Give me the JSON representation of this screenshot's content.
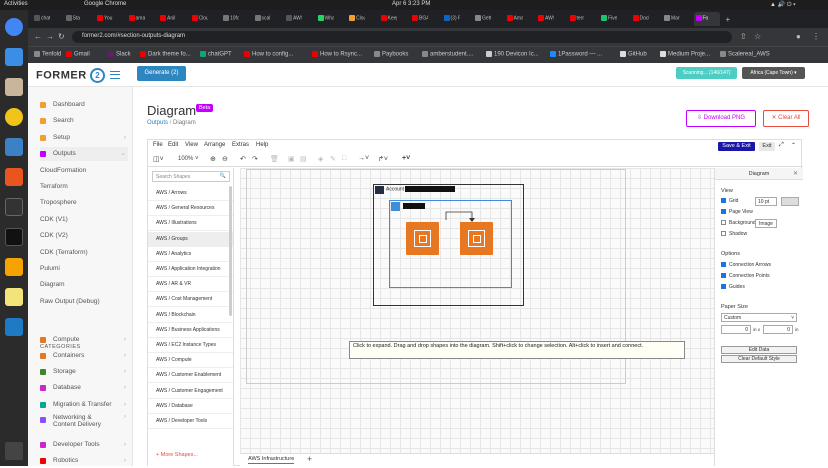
{
  "os": {
    "activities": "Activities",
    "app": "Google Chrome",
    "clock": "Apr 6  3:23 PM"
  },
  "browser": {
    "tabs": [
      {
        "label": "chat",
        "color": "#555"
      },
      {
        "label": "Sta",
        "color": "#666"
      },
      {
        "label": "You",
        "color": "#e00"
      },
      {
        "label": "ama",
        "color": "#e00"
      },
      {
        "label": "Anil",
        "color": "#e00"
      },
      {
        "label": "Clou",
        "color": "#e00"
      },
      {
        "label": "10fo",
        "color": "#777"
      },
      {
        "label": "scal",
        "color": "#777"
      },
      {
        "label": "AWS",
        "color": "#555"
      },
      {
        "label": "Wha",
        "color": "#25d366"
      },
      {
        "label": "Clou",
        "color": "#f0a030"
      },
      {
        "label": "Keep",
        "color": "#e00"
      },
      {
        "label": "BGA",
        "color": "#e00"
      },
      {
        "label": "(3) F",
        "color": "#0a66c2"
      },
      {
        "label": "Getti",
        "color": "#888"
      },
      {
        "label": "Amaz",
        "color": "#e00"
      },
      {
        "label": "AWS",
        "color": "#e00"
      },
      {
        "label": "terr",
        "color": "#e00"
      },
      {
        "label": "Fiver",
        "color": "#1dbf73"
      },
      {
        "label": "Docl",
        "color": "#e00"
      },
      {
        "label": "Mark",
        "color": "#888"
      },
      {
        "label": "Fo",
        "color": "#c300ff",
        "active": true
      }
    ],
    "url": "former2.com/#section-outputs-diagram",
    "bookmarks": [
      {
        "label": "Tenfold",
        "color": "#888"
      },
      {
        "label": "Gmail",
        "color": "#e00"
      },
      {
        "label": "Slack",
        "color": "#611f69"
      },
      {
        "label": "Dark theme fo...",
        "color": "#e00"
      },
      {
        "label": "chatGPT",
        "color": "#10a37f"
      },
      {
        "label": "How to config...",
        "color": "#e00"
      },
      {
        "label": "How to Rsync...",
        "color": "#e00"
      },
      {
        "label": "Paybooks",
        "color": "#888"
      },
      {
        "label": "amberstudent....",
        "color": "#888"
      },
      {
        "label": "190 Devicon Ic...",
        "color": "#ccc"
      },
      {
        "label": "1Password — ...",
        "color": "#1a8cff"
      },
      {
        "label": "GitHub",
        "color": "#ddd"
      },
      {
        "label": "Medium Proje...",
        "color": "#ddd"
      },
      {
        "label": "Scalereal_AWS",
        "color": "#888"
      }
    ]
  },
  "header": {
    "logo": "FORMER",
    "logo_num": "2",
    "generate": "Generate (2)",
    "scanning": "Scanning... (146/147)",
    "region": "Africa (Cape Town) ▾"
  },
  "sidebar": {
    "items": [
      {
        "label": "Dashboard",
        "color": "#f0a030",
        "chevron": ""
      },
      {
        "label": "Search",
        "color": "#f0a030",
        "chevron": ""
      },
      {
        "label": "Setup",
        "color": "#f0a030",
        "chevron": "›"
      },
      {
        "label": "Outputs",
        "color": "#c300ff",
        "chevron": "⌄"
      },
      {
        "label": "CloudFormation"
      },
      {
        "label": "Terraform"
      },
      {
        "label": "Troposphere"
      },
      {
        "label": "CDK (V1)"
      },
      {
        "label": "CDK (V2)"
      },
      {
        "label": "CDK (Terraform)"
      },
      {
        "label": "Pulumi"
      },
      {
        "label": "Diagram"
      },
      {
        "label": "Raw Output (Debug)"
      }
    ],
    "categories_label": "CATEGORIES",
    "categories": [
      {
        "label": "Compute",
        "color": "#e87722"
      },
      {
        "label": "Containers",
        "color": "#e87722"
      },
      {
        "label": "Storage",
        "color": "#3f8624"
      },
      {
        "label": "Database",
        "color": "#c925d1"
      },
      {
        "label": "Migration & Transfer",
        "color": "#01a88d"
      },
      {
        "label": "Networking & Content Delivery",
        "color": "#8c4fff"
      },
      {
        "label": "Developer Tools",
        "color": "#c925d1"
      },
      {
        "label": "Robotics",
        "color": "#e00"
      }
    ]
  },
  "main": {
    "title": "Diagram",
    "beta": "Beta",
    "crumb_root": "Outputs",
    "crumb_sep": "/",
    "crumb_cur": "Diagram",
    "download": "Download PNG",
    "clear": "Clear All"
  },
  "editor": {
    "menus": [
      "File",
      "Edit",
      "View",
      "Arrange",
      "Extras",
      "Help"
    ],
    "save_exit": "Save & Exit",
    "exit": "Exit",
    "zoom": "100%",
    "search_placeholder": "Search Shapes",
    "shapes": [
      "AWS / Arrows",
      "AWS / General Resources",
      "AWS / Illustrations",
      "AWS / Groups",
      "AWS / Analytics",
      "AWS / Application Integration",
      "AWS / AR & VR",
      "AWS / Cost Management",
      "AWS / Blockchain",
      "AWS / Business Applications",
      "AWS / EC2 Instance Types",
      "AWS / Compute",
      "AWS / Customer Enablement",
      "AWS / Customer Engagement",
      "AWS / Database",
      "AWS / Developer Tools"
    ],
    "more_shapes": "+ More Shapes...",
    "account_label": "Account",
    "tooltip": "Click to expand. Drag and drop shapes into the diagram. Shift+click to change selection. Alt+click to insert and connect.",
    "page_tab": "AWS Infrastructure",
    "add_page": "+"
  },
  "format": {
    "title": "Diagram",
    "view_label": "View",
    "grid": "Grid",
    "grid_size": "10 pt",
    "page_view": "Page View",
    "background": "Background",
    "image_btn": "Image",
    "shadow": "Shadow",
    "options_label": "Options",
    "connection_arrows": "Connection Arrows",
    "connection_points": "Connection Points",
    "guides": "Guides",
    "paper_label": "Paper Size",
    "paper_value": "Custom",
    "width": "0",
    "width_unit": "in x",
    "height": "0",
    "height_unit": "in",
    "edit_data": "Edit Data",
    "clear_default": "Clear Default Style"
  }
}
